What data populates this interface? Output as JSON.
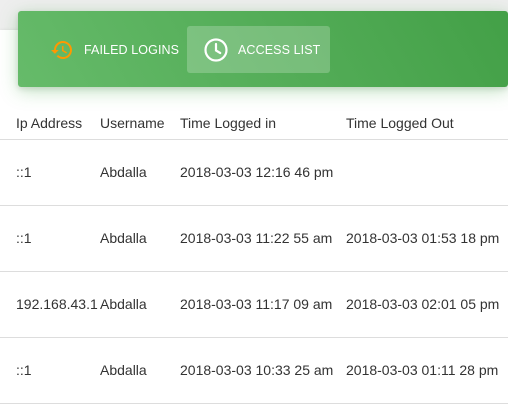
{
  "tabs": {
    "failed_logins": "FAILED LOGINS",
    "access_list": "ACCESS LIST"
  },
  "colors": {
    "header_green": "#4caf50",
    "failed_icon": "#ff9800"
  },
  "table": {
    "headers": [
      "Ip Address",
      "Username",
      "Time Logged in",
      "Time Logged Out"
    ],
    "rows": [
      {
        "ip": "::1",
        "username": "Abdalla",
        "time_in": "2018-03-03 12:16 46 pm",
        "time_out": ""
      },
      {
        "ip": "::1",
        "username": "Abdalla",
        "time_in": "2018-03-03 11:22 55 am",
        "time_out": "2018-03-03 01:53 18 pm"
      },
      {
        "ip": "192.168.43.1",
        "username": "Abdalla",
        "time_in": "2018-03-03 11:17 09 am",
        "time_out": "2018-03-03 02:01 05 pm"
      },
      {
        "ip": "::1",
        "username": "Abdalla",
        "time_in": "2018-03-03 10:33 25 am",
        "time_out": "2018-03-03 01:11 28 pm"
      }
    ]
  }
}
